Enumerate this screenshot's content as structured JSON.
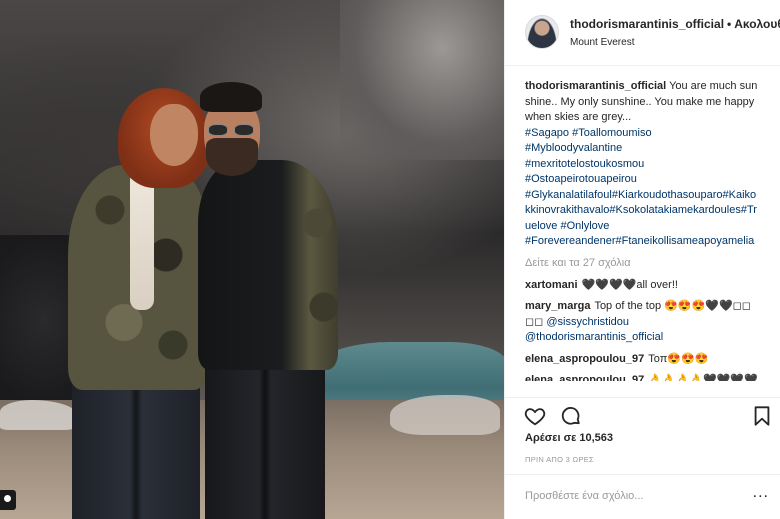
{
  "post": {
    "username": "thodorismarantinis_official",
    "follow_label": "Ακολουθ",
    "location": "Mount Everest",
    "caption_text": "You are much sunshine.. My only sunshine.. You make me happy when skies are grey...",
    "hashtags": [
      "#Sagapo #Toallomoumiso",
      "#Mybloodyvalantine",
      "#mexritotelostoukosmou",
      "#Ostoapeirotouapeirou",
      "#Glykanalatilafoul#Kiarkoudothasouparo#Kaikokkinovrakithavalo#Ksokolatakiamekardoules#Truelove #Onlylove",
      "#Forevereandener#Ftaneikollisameapoyamelia"
    ],
    "view_more_comments": "Δείτε και τα 27 σχόλια",
    "comments": [
      {
        "user": "xartomani",
        "text": "🖤🖤🖤🖤all over!!"
      },
      {
        "user": "mary_marga",
        "text": "Top of the top 😍😍😍🖤🖤◻◻ ◻◻",
        "mentions": [
          "@sissychristidou",
          "@thodorismarantinis_official"
        ]
      },
      {
        "user": "elena_aspropoulou_97",
        "text": "Τοπ😍😍😍"
      },
      {
        "user": "elena_aspropoulou_97",
        "text": "👌👌👌👌🖤🖤🖤🖤"
      }
    ],
    "likes_text": "Αρέσει σε 10,563",
    "time_ago": "ΠΡΙΝ ΑΠΟ 3 ΩΡΕΣ",
    "add_comment_placeholder": "Προσθέστε ένα σχόλιο...",
    "more_options": "..."
  },
  "icons": {
    "like": "heart-icon",
    "comment": "speech-bubble-icon",
    "save": "bookmark-icon",
    "photo_user_tag": "user-tag-icon"
  }
}
